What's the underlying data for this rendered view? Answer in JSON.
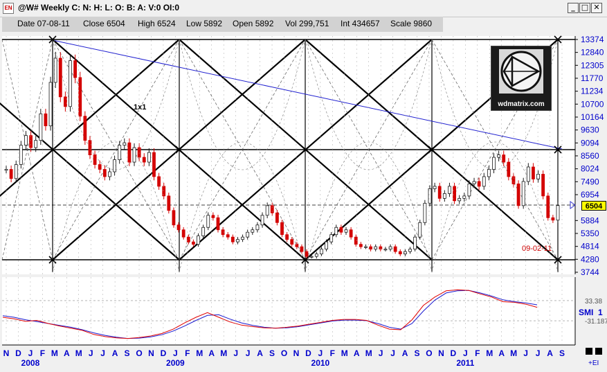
{
  "window": {
    "title": "@W# Weekly C: N: H: L: O: B: A: V:0 OI:0",
    "icon_label": "EN",
    "min_glyph": "_",
    "max_glyph": "□",
    "close_glyph": "✕"
  },
  "info_bar": {
    "date": "Date 07-08-11",
    "close": "Close 6504",
    "high": "High 6524",
    "low": "Low 5892",
    "open": "Open 5892",
    "vol": "Vol 299,751",
    "int": "Int 434657",
    "scale": "Scale 9860"
  },
  "logo": {
    "text": "wdmatrix.com"
  },
  "labels": {
    "ratio": "1x1",
    "date_mark": "09-02-11",
    "last_price": "6504",
    "smi": "SMI",
    "smi_suffix": "1",
    "ei": "+EI"
  },
  "colors": {
    "background": "#ffffff",
    "up_bar": "#1a1a1a",
    "down_bar": "#d40000",
    "trend_line": "#1f1fd0",
    "axis_text": "#0000cc",
    "price_highlight": "#ffff00",
    "smi_fast": "#e00000",
    "smi_slow": "#1a1ad0"
  },
  "chart_data": {
    "type": "candlestick",
    "price_axis": {
      "ticks": [
        "13374",
        "12840",
        "12305",
        "11770",
        "11234",
        "10700",
        "10164",
        "9630",
        "9094",
        "8560",
        "8024",
        "7490",
        "6954",
        "6504",
        "5884",
        "5350",
        "4814",
        "4280",
        "3744"
      ],
      "range": [
        3744,
        13374
      ]
    },
    "x_axis": {
      "months": [
        "N",
        "D",
        "J",
        "F",
        "M",
        "A",
        "M",
        "J",
        "J",
        "A",
        "S",
        "O",
        "N",
        "D",
        "J",
        "F",
        "M",
        "A",
        "M",
        "J",
        "J",
        "A",
        "S",
        "O",
        "N",
        "D",
        "J",
        "F",
        "M",
        "A",
        "M",
        "J",
        "J",
        "A",
        "S",
        "O",
        "N",
        "D",
        "J",
        "F",
        "M",
        "A",
        "M",
        "J",
        "J",
        "A",
        "S"
      ],
      "years": [
        {
          "label": "2008",
          "month_index": 2
        },
        {
          "label": "2009",
          "month_index": 14
        },
        {
          "label": "2010",
          "month_index": 26
        },
        {
          "label": "2011",
          "month_index": 38
        }
      ]
    },
    "weekly_closes": [
      8000,
      7620,
      8200,
      9000,
      9400,
      8900,
      9200,
      10300,
      9800,
      11600,
      12600,
      11000,
      10600,
      12500,
      11800,
      10200,
      9200,
      8600,
      8200,
      8000,
      7700,
      7900,
      8400,
      9000,
      9100,
      8300,
      8900,
      8500,
      8300,
      8700,
      7700,
      7300,
      6900,
      6300,
      5700,
      5500,
      5200,
      5000,
      4900,
      5250,
      5600,
      6100,
      6000,
      5500,
      5300,
      5200,
      5000,
      5100,
      5200,
      5400,
      5500,
      5700,
      6100,
      6500,
      6200,
      5800,
      5300,
      5100,
      4900,
      4800,
      4600,
      4400,
      4400,
      4500,
      4700,
      5000,
      5300,
      5600,
      5400,
      5500,
      5200,
      4900,
      4800,
      4800,
      4700,
      4800,
      4700,
      4700,
      4800,
      4600,
      4500,
      4600,
      4700,
      5200,
      5800,
      6600,
      7200,
      7300,
      6800,
      7000,
      7300,
      6700,
      6800,
      6900,
      7400,
      7500,
      7300,
      7700,
      8000,
      8500,
      8600,
      8300,
      7700,
      7400,
      6500,
      7500,
      8100,
      7600,
      7800,
      6900,
      6000,
      5900,
      6504
    ],
    "smi_axis": {
      "ticks": [
        "33.38",
        "-31.187"
      ]
    },
    "smi": {
      "fast": [
        -20,
        -25,
        -33,
        -30,
        -40,
        -48,
        -55,
        -62,
        -75,
        -82,
        -86,
        -88,
        -85,
        -80,
        -72,
        -58,
        -38,
        -20,
        -5,
        -20,
        -35,
        -45,
        -50,
        -54,
        -55,
        -52,
        -48,
        -42,
        -36,
        -30,
        -27,
        -27,
        -30,
        -45,
        -58,
        -60,
        -28,
        18,
        45,
        65,
        68,
        66,
        55,
        45,
        30,
        28,
        22,
        12
      ],
      "slow": [
        -15,
        -20,
        -28,
        -34,
        -40,
        -46,
        -52,
        -60,
        -70,
        -78,
        -84,
        -88,
        -87,
        -83,
        -76,
        -64,
        -48,
        -30,
        -14,
        -12,
        -26,
        -38,
        -46,
        -52,
        -55,
        -54,
        -50,
        -44,
        -38,
        -32,
        -29,
        -29,
        -31,
        -40,
        -52,
        -58,
        -40,
        0,
        35,
        58,
        65,
        66,
        58,
        48,
        36,
        30,
        26,
        20
      ]
    }
  }
}
